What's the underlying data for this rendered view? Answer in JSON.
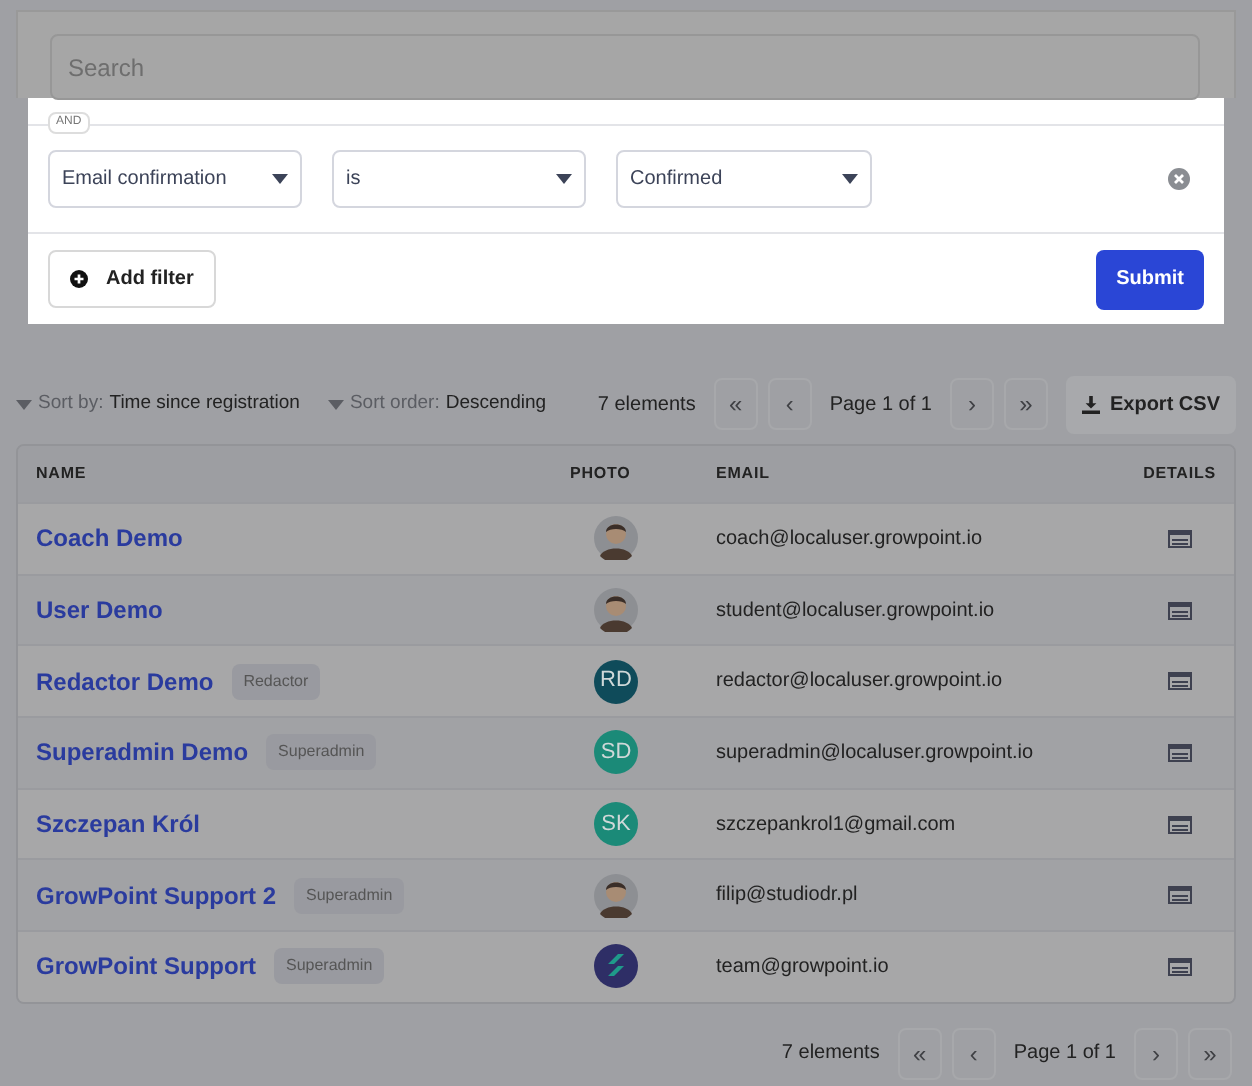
{
  "search": {
    "placeholder": "Search"
  },
  "filter": {
    "connector": "AND",
    "rules": [
      {
        "field": "Email confirmation",
        "operator": "is",
        "value": "Confirmed"
      }
    ],
    "add_button": "Add filter",
    "submit_button": "Submit"
  },
  "toolbar": {
    "sort_by": {
      "label": "Sort by:",
      "value": "Time since registration"
    },
    "sort_order": {
      "label": "Sort order:",
      "value": "Descending"
    },
    "count": "7 elements",
    "page": "Page 1 of 1",
    "first": "«",
    "prev": "‹",
    "next": "›",
    "last": "»",
    "export_button": "Export CSV"
  },
  "table": {
    "columns": [
      "NAME",
      "PHOTO",
      "EMAIL",
      "DETAILS"
    ],
    "rows": [
      {
        "name": "Coach Demo",
        "photo": {
          "kind": "photo"
        },
        "email": "coach@localuser.growpoint.io"
      },
      {
        "name": "User Demo",
        "photo": {
          "kind": "photo"
        },
        "email": "student@localuser.growpoint.io"
      },
      {
        "name": "Redactor Demo",
        "badge": "Redactor",
        "photo": {
          "kind": "initials",
          "text": "RD",
          "color": "#0f4b5a"
        },
        "email": "redactor@localuser.growpoint.io"
      },
      {
        "name": "Superadmin Demo",
        "badge": "Superadmin",
        "photo": {
          "kind": "initials",
          "text": "SD",
          "color": "#1b8a78"
        },
        "email": "superadmin@localuser.growpoint.io"
      },
      {
        "name": "Szczepan Król",
        "photo": {
          "kind": "initials",
          "text": "SK",
          "color": "#1b8a78"
        },
        "email": "szczepankrol1@gmail.com"
      },
      {
        "name": "GrowPoint Support 2",
        "badge": "Superadmin",
        "photo": {
          "kind": "photo"
        },
        "email": "filip@studiodr.pl"
      },
      {
        "name": "GrowPoint Support",
        "badge": "Superadmin",
        "photo": {
          "kind": "logo",
          "color": "#2e2e66"
        },
        "email": "team@growpoint.io"
      }
    ]
  },
  "footer": {
    "count": "7 elements",
    "page": "Page 1 of 1",
    "first": "«",
    "prev": "‹",
    "next": "›",
    "last": "»"
  }
}
